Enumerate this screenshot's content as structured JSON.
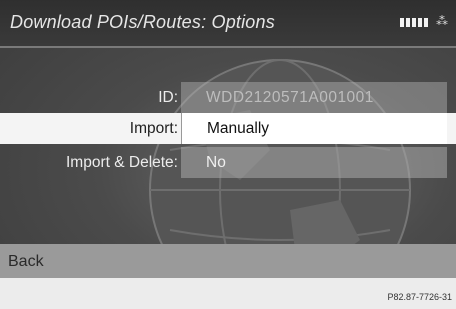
{
  "header": {
    "title": "Download POIs/Routes: Options",
    "signal_icon": "signal-strength-icon",
    "connection_icon": "connection-icon"
  },
  "fields": {
    "id": {
      "label": "ID:",
      "value": "WDD2120571A001001"
    },
    "import": {
      "label": "Import:",
      "value": "Manually"
    },
    "import_delete": {
      "label": "Import & Delete:",
      "value": "No"
    }
  },
  "back": {
    "label": "Back"
  },
  "reference": "P82.87-7726-31"
}
